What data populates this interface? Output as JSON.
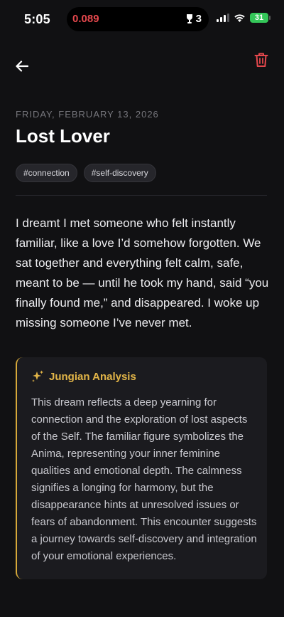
{
  "status_bar": {
    "time": "5:05",
    "island_value": "0.089",
    "island_count": "3",
    "battery": "31"
  },
  "header": {
    "back_icon": "arrow-left-icon",
    "delete_icon": "trash-icon"
  },
  "entry": {
    "date": "FRIDAY, FEBRUARY 13, 2026",
    "title": "Lost Lover",
    "tags": [
      "#connection",
      "#self-discovery"
    ],
    "dream_text": "I dreamt I met someone who felt instantly familiar, like a love I’d somehow forgotten. We sat together and everything felt calm, safe, meant to be — until he took my hand, said “you finally found me,” and disappeared. I woke up missing someone I’ve never met."
  },
  "analysis": {
    "icon": "sparkles-icon",
    "title": "Jungian Analysis",
    "body": "This dream reflects a deep yearning for connection and the exploration of lost aspects of the Self. The familiar figure symbolizes the Anima, representing your inner feminine qualities and emotional depth. The calmness signifies a longing for harmony, but the disappearance hints at unresolved issues or fears of abandonment. This encounter suggests a journey towards self-discovery and integration of your emotional experiences."
  },
  "colors": {
    "background": "#111113",
    "accent_gold": "#e2b548",
    "delete_red": "#e5484d",
    "island_red": "#e5484d",
    "battery_green": "#34c759"
  }
}
